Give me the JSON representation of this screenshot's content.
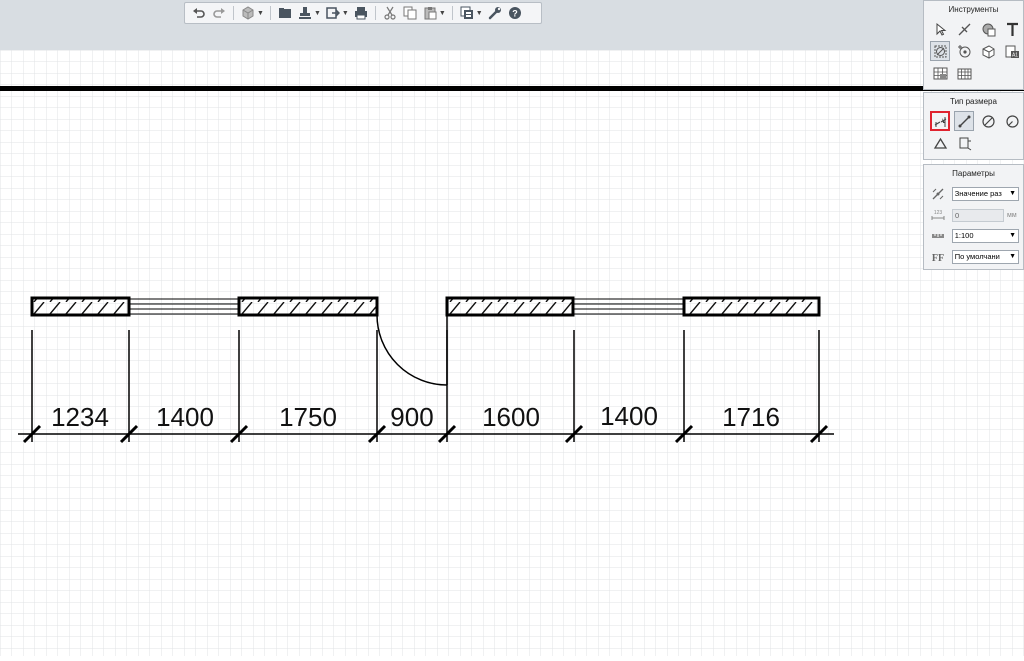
{
  "toolbar": {
    "buttons": [
      {
        "name": "undo-icon"
      },
      {
        "name": "redo-icon"
      },
      {
        "name": "3d-view-icon"
      },
      {
        "name": "save-icon"
      },
      {
        "name": "stamp-icon"
      },
      {
        "name": "export-icon"
      },
      {
        "name": "print-icon"
      },
      {
        "name": "cut-icon"
      },
      {
        "name": "copy-icon"
      },
      {
        "name": "paste-icon"
      },
      {
        "name": "layers-icon"
      },
      {
        "name": "settings-wrench-icon"
      },
      {
        "name": "help-icon"
      }
    ]
  },
  "tools_panel": {
    "title": "Инструменты",
    "icons": [
      "select-arrow-icon",
      "line-tool-icon",
      "hatch-fill-icon",
      "text-tool-icon",
      "dimension-diameter-icon",
      "snap-point-icon",
      "3d-box-icon",
      "sheet-a1-icon",
      "table-image-icon",
      "table-grid-icon"
    ]
  },
  "dimension_type_panel": {
    "title": "Тип размера",
    "icons": [
      "linear-dimension-icon",
      "aligned-dimension-icon",
      "diameter-dimension-icon",
      "radius-dimension-icon",
      "angle-dimension-icon",
      "leader-dimension-icon"
    ]
  },
  "params_panel": {
    "title": "Параметры",
    "value_mode": "Значение раз",
    "offset_value": "0",
    "offset_unit": "мм",
    "scale": "1:100",
    "font": "По умолчани"
  },
  "drawing": {
    "dimensions": [
      "1234",
      "1400",
      "1750",
      "900",
      "1600",
      "1400",
      "1716"
    ]
  },
  "colors": {
    "topbar": "#d8dde2",
    "grid_line": "#dde0e4",
    "selection_red": "#e0232f"
  }
}
